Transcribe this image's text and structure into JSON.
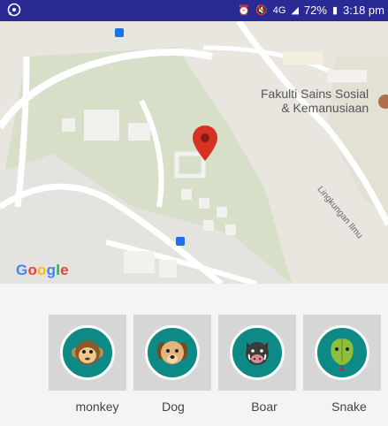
{
  "status_bar": {
    "left_icon": "whatsapp-icon",
    "battery": "72%",
    "time": "3:18 pm",
    "network": "4G"
  },
  "map": {
    "place_label": "Fakulti Sains Sosial\n& Kemanusiaan",
    "road_label": "Lingkungan Ilmu",
    "attribution": "Google"
  },
  "animals": [
    {
      "name": "monkey",
      "icon": "monkey-icon"
    },
    {
      "name": "Dog",
      "icon": "dog-icon"
    },
    {
      "name": "Boar",
      "icon": "boar-icon"
    },
    {
      "name": "Snake",
      "icon": "snake-icon"
    }
  ],
  "colors": {
    "status_bar": "#2a2a94",
    "avatar_bg": "#0d8a86",
    "pin": "#d93025"
  }
}
